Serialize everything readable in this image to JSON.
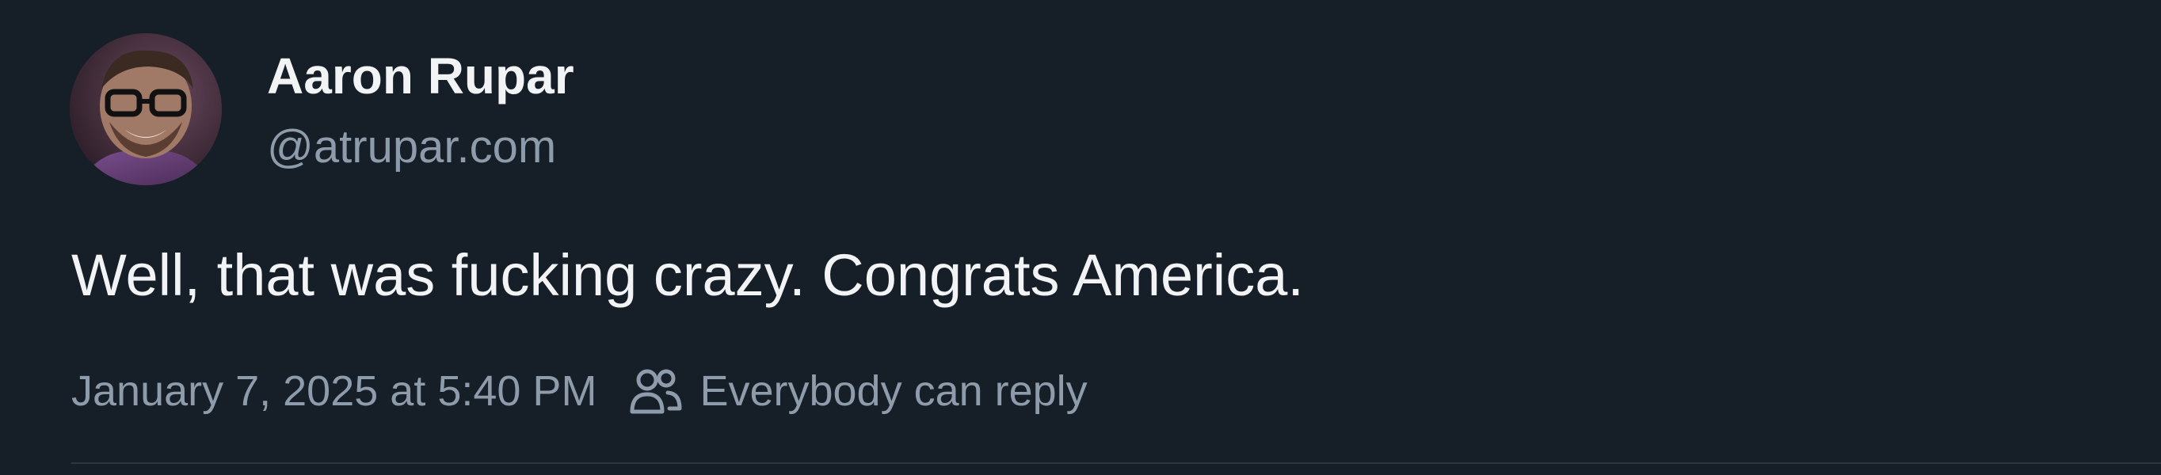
{
  "post": {
    "author": {
      "display_name": "Aaron Rupar",
      "handle": "@atrupar.com",
      "avatar_icon": "profile-photo"
    },
    "text": "Well, that was fucking crazy. Congrats America.",
    "timestamp": "January 7, 2025 at 5:40 PM",
    "reply_setting": {
      "icon": "people-icon",
      "label": "Everybody can reply"
    }
  },
  "colors": {
    "background": "#161e27",
    "primary_text": "#f1f3f5",
    "secondary_text": "#8d9bab",
    "divider": "#2b3643"
  }
}
